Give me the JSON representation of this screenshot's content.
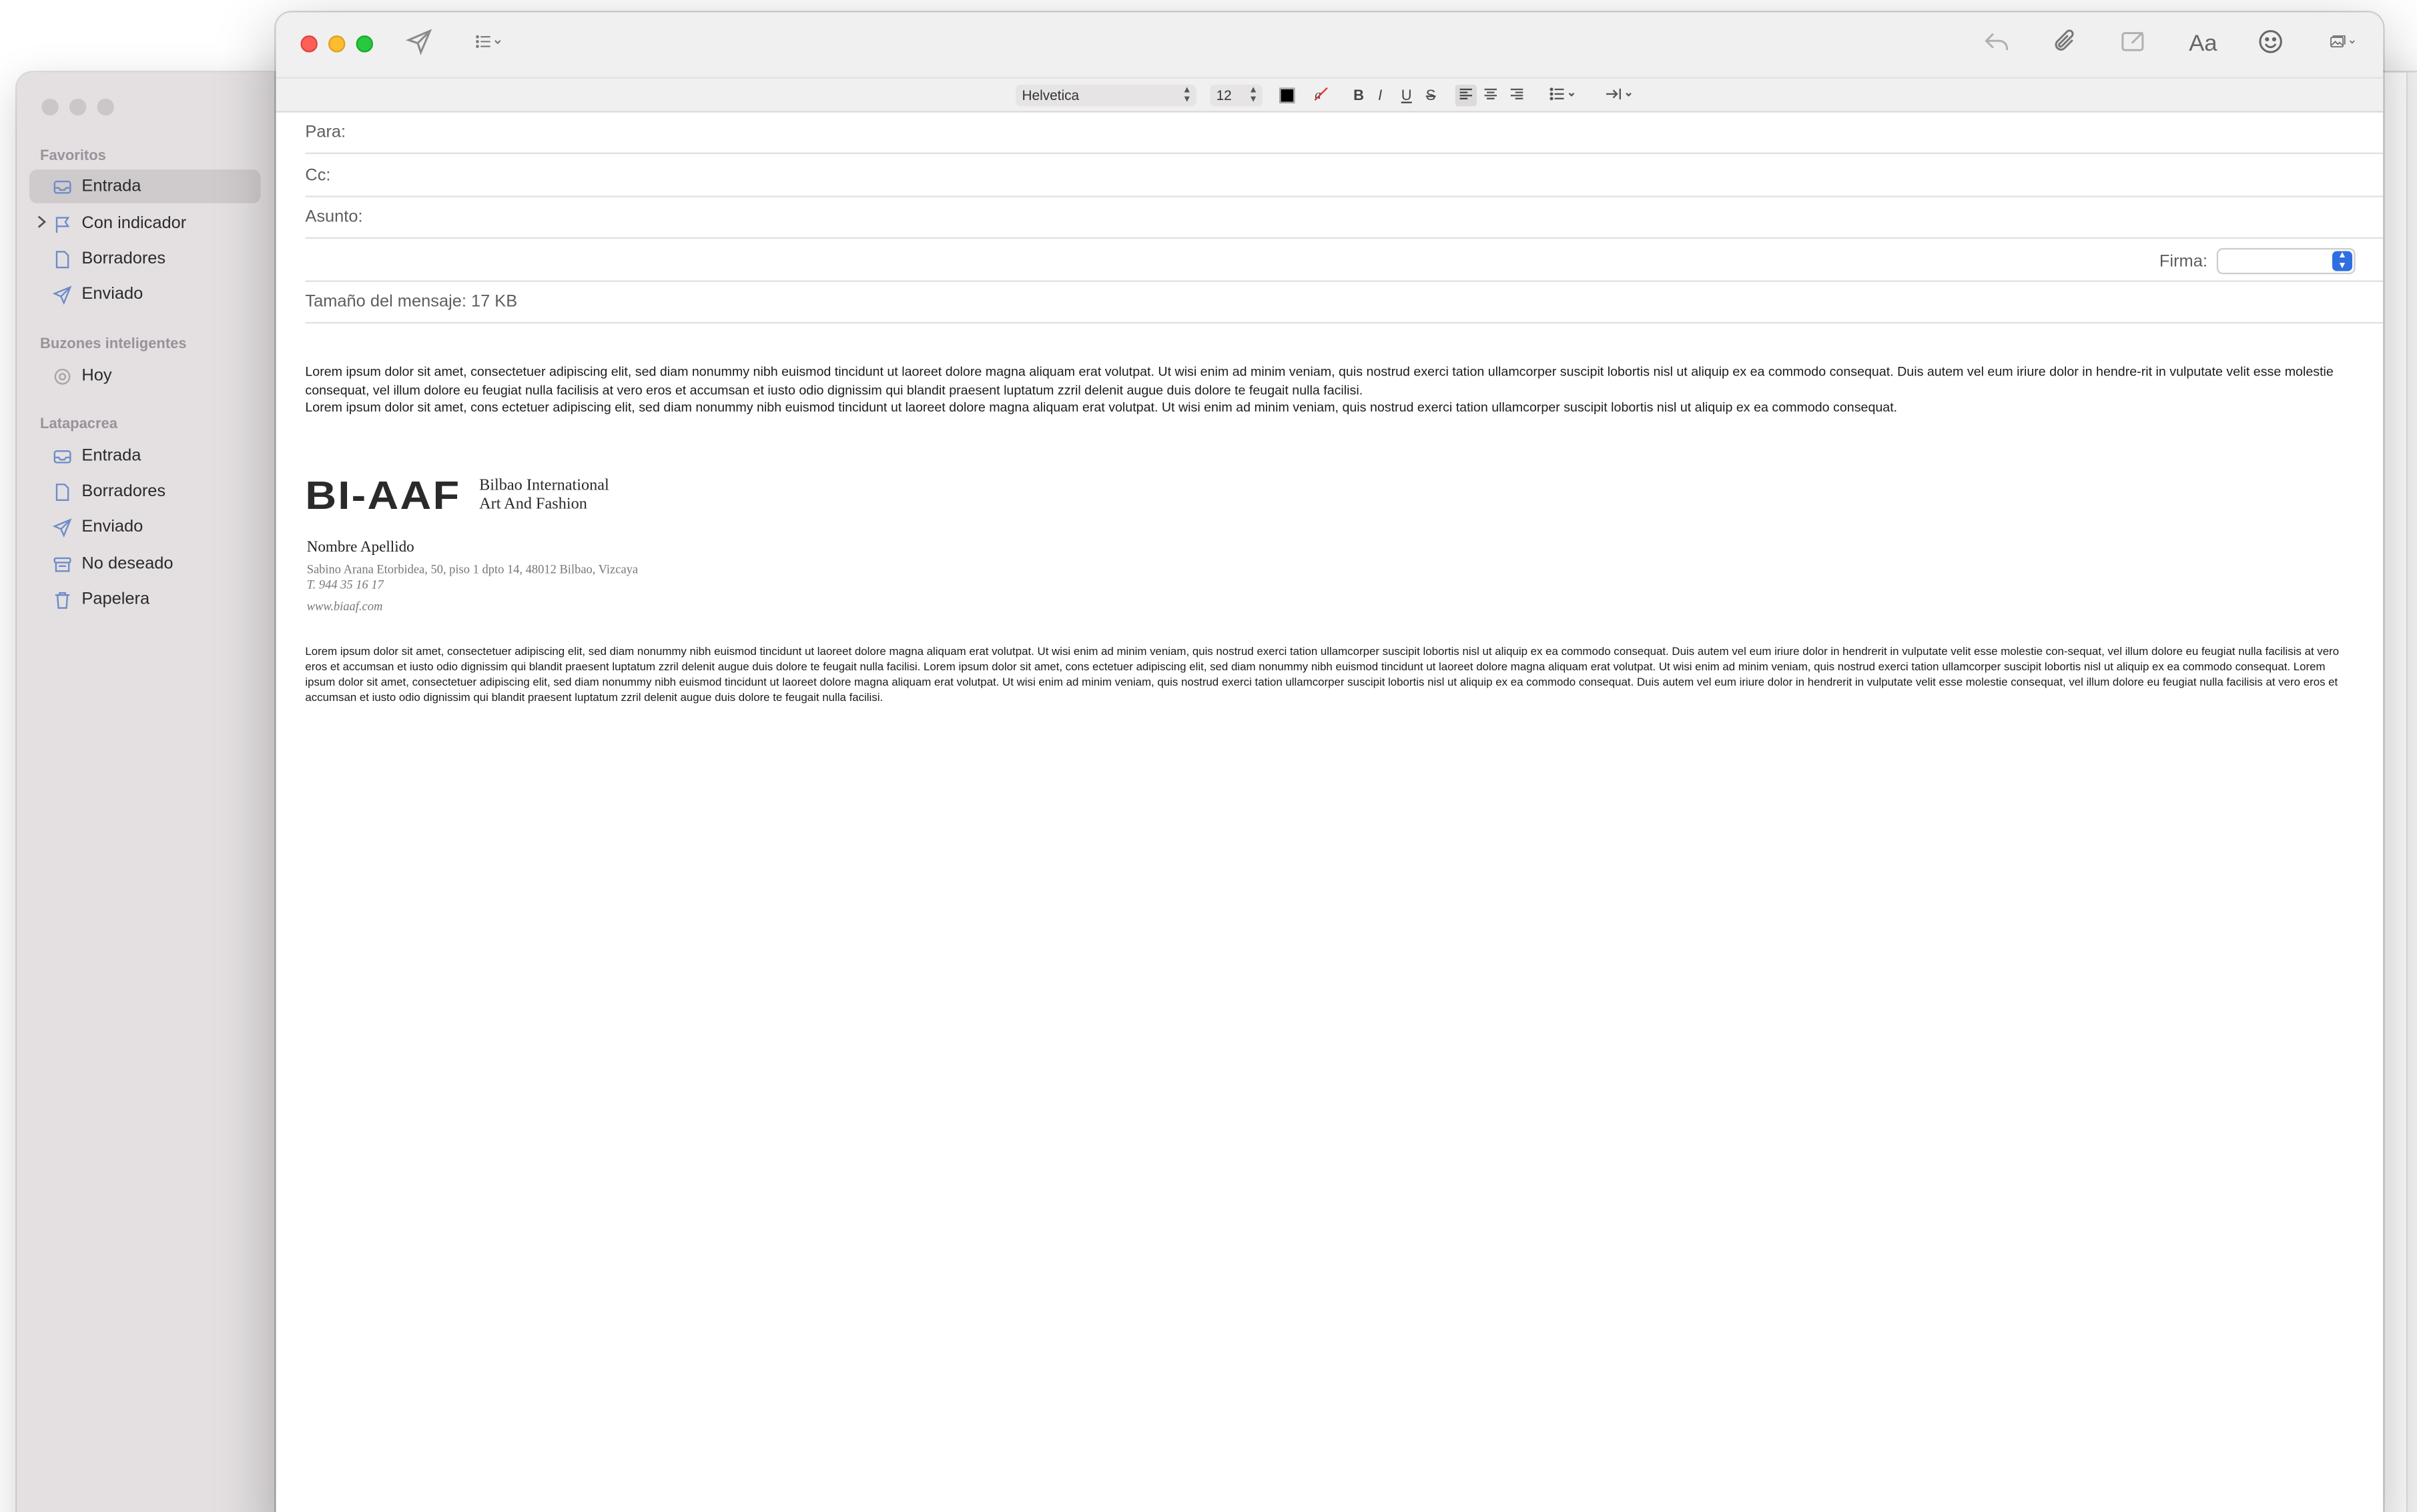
{
  "sidebar": {
    "sections": [
      {
        "title": "Favoritos"
      },
      {
        "title": "Buzones inteligentes"
      },
      {
        "title": "Latapacrea"
      }
    ],
    "favoritos": [
      {
        "label": "Entrada",
        "icon": "inbox-icon",
        "selected": true
      },
      {
        "label": "Con indicador",
        "icon": "flag-icon"
      },
      {
        "label": "Borradores",
        "icon": "document-icon"
      },
      {
        "label": "Enviado",
        "icon": "paperplane-icon"
      }
    ],
    "smart": [
      {
        "label": "Hoy",
        "icon": "gear-icon"
      }
    ],
    "account": [
      {
        "label": "Entrada",
        "icon": "inbox-icon"
      },
      {
        "label": "Borradores",
        "icon": "document-icon"
      },
      {
        "label": "Enviado",
        "icon": "paperplane-icon"
      },
      {
        "label": "No deseado",
        "icon": "junk-icon"
      },
      {
        "label": "Papelera",
        "icon": "trash-icon"
      }
    ]
  },
  "toolbar": {
    "aa_label": "Aa"
  },
  "format": {
    "font": "Helvetica",
    "size": "12",
    "bold": "B",
    "italic": "I",
    "underline": "U",
    "strike": "S"
  },
  "compose": {
    "to_label": "Para:",
    "cc_label": "Cc:",
    "subject_label": "Asunto:",
    "signature_label": "Firma:",
    "message_size": "Tamaño del mensaje: 17 KB"
  },
  "body": {
    "para1": "Lorem ipsum dolor sit amet, consectetuer adipiscing elit, sed diam nonummy nibh euismod tincidunt ut laoreet dolore magna aliquam erat volutpat. Ut wisi enim ad minim veniam, quis nostrud exerci tation ullamcorper suscipit lobortis nisl ut aliquip ex ea commodo consequat. Duis autem vel eum iriure dolor in hendre-rit in vulputate velit esse molestie consequat, vel illum dolore eu feugiat nulla facilisis at vero eros et accumsan et iusto odio dignissim qui blandit praesent luptatum zzril delenit augue duis dolore te feugait nulla facilisi.",
    "para2": "Lorem ipsum dolor sit amet, cons ectetuer adipiscing elit, sed diam nonummy nibh euismod tincidunt ut laoreet dolore magna aliquam erat volutpat. Ut wisi enim ad minim veniam, quis nostrud exerci tation ullamcorper suscipit lobortis nisl ut aliquip ex ea commodo consequat.",
    "disclaimer": "Lorem ipsum dolor sit amet, consectetuer adipiscing elit, sed diam nonummy nibh euismod tincidunt ut laoreet dolore magna aliquam erat volutpat. Ut wisi enim ad minim veniam, quis nostrud exerci tation ullamcorper suscipit lobortis nisl ut aliquip ex ea commodo consequat. Duis autem vel eum iriure dolor in hendrerit in vulputate velit esse molestie con-sequat, vel illum dolore eu feugiat nulla facilisis at vero eros et accumsan et iusto odio dignissim qui blandit praesent luptatum zzril delenit augue duis dolore te feugait nulla facilisi. Lorem ipsum dolor sit amet, cons ectetuer adipiscing elit, sed diam nonummy nibh euismod tincidunt ut laoreet dolore magna aliquam erat volutpat. Ut wisi enim ad minim veniam, quis nostrud exerci tation ullamcorper suscipit lobortis nisl ut aliquip ex ea commodo consequat. Lorem ipsum dolor sit amet, consectetuer adipiscing elit, sed diam nonummy nibh euismod tincidunt ut laoreet dolore magna aliquam erat volutpat. Ut wisi enim ad minim veniam, quis nostrud exerci tation ullamcorper suscipit lobortis nisl ut aliquip ex ea commodo consequat. Duis autem vel eum iriure dolor in hendrerit in vulputate velit esse molestie consequat, vel illum dolore eu feugiat nulla facilisis at vero eros et accumsan et iusto odio dignissim qui blandit praesent luptatum zzril delenit augue duis dolore te feugait nulla facilisi."
  },
  "signature": {
    "logo_mark": "BI-AAF",
    "logo_line1": "Bilbao International",
    "logo_line2": "Art And Fashion",
    "name": "Nombre Apellido",
    "address": "Sabino Arana Etorbidea, 50, piso 1 dpto 14, 48012 Bilbao, Vizcaya",
    "phone": "T. 944 35 16 17",
    "web": "www.biaaf.com"
  }
}
